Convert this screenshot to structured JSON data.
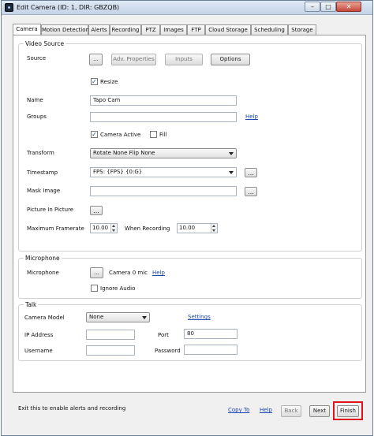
{
  "window": {
    "title": "Edit Camera (ID: 1, DIR: GBZQB)",
    "minimize_glyph": "–",
    "maximize_glyph": "□",
    "close_glyph": "✕"
  },
  "tabs": [
    "Camera",
    "Motion Detection",
    "Alerts",
    "Recording",
    "PTZ",
    "Images",
    "FTP",
    "Cloud Storage",
    "Scheduling",
    "Storage"
  ],
  "video_source": {
    "group_label": "Video Source",
    "source_label": "Source",
    "source_button": "...",
    "adv_properties_button": "Adv. Properties",
    "inputs_button": "Inputs",
    "options_button": "Options",
    "resize_label": "Resize",
    "resize_checked": true,
    "name_label": "Name",
    "name_value": "Tapo Cam",
    "groups_label": "Groups",
    "groups_value": "",
    "groups_help": "Help",
    "camera_active_label": "Camera Active",
    "camera_active_checked": true,
    "fill_label": "Fill",
    "fill_checked": false,
    "transform_label": "Transform",
    "transform_value": "Rotate None Flip None",
    "timestamp_label": "Timestamp",
    "timestamp_value": "FPS: {FPS} {0:G}",
    "timestamp_button": "...",
    "mask_image_label": "Mask Image",
    "mask_image_value": "",
    "mask_image_button": "...",
    "pip_label": "Picture In Picture",
    "pip_button": "...",
    "max_framerate_label": "Maximum Framerate",
    "max_framerate_value": "10.00",
    "when_recording_label": "When Recording",
    "when_recording_value": "10.00"
  },
  "microphone": {
    "group_label": "Microphone",
    "mic_label": "Microphone",
    "mic_button": "...",
    "mic_value": "Camera 0 mic",
    "help": "Help",
    "ignore_audio_label": "Ignore Audio",
    "ignore_audio_checked": false
  },
  "talk": {
    "group_label": "Talk",
    "camera_model_label": "Camera Model",
    "camera_model_value": "None",
    "settings_link": "Settings",
    "ip_label": "IP Address",
    "ip_value": "",
    "port_label": "Port",
    "port_value": "80",
    "username_label": "Username",
    "username_value": "",
    "password_label": "Password",
    "password_value": ""
  },
  "footer": {
    "status_text": "Exit this to enable alerts and recording",
    "copy_to": "Copy To",
    "help": "Help",
    "back": "Back",
    "next": "Next",
    "finish": "Finish"
  },
  "colors": {
    "highlight": "#e0141b",
    "link": "#1a45b8"
  }
}
